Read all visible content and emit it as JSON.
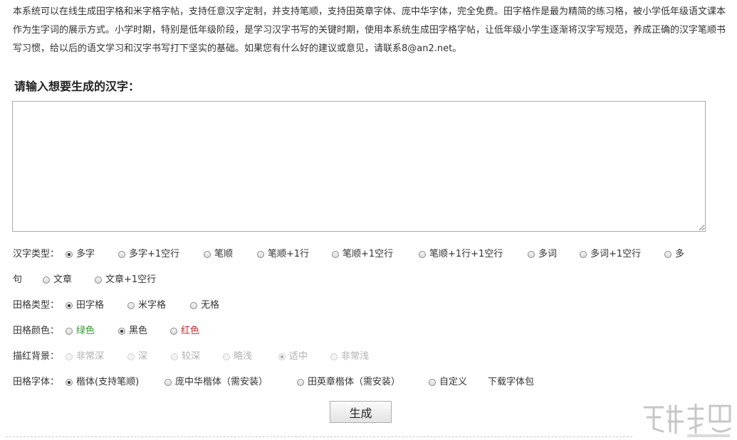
{
  "intro": {
    "text": "本系统可以在线生成田字格和米字格字帖，支持任意汉字定制，并支持笔顺，支持田英章字体、庞中华字体，完全免费。田字格作是最为精简的练习格，被小学低年级语文课本作为生字词的展示方式。小学时期，特别是低年级阶段，是学习汉字书写的关键时期，使用本系统生成田字格字帖，让低年级小学生逐渐将汉字写规范，养成正确的汉字笔顺书写习惯，给以后的语文学习和汉字书写打下坚实的基础。如果您有什么好的建议或意见，请联系8@an2.net。"
  },
  "prompt": {
    "title": "请输入想要生成的汉字：",
    "value": ""
  },
  "char_type": {
    "label": "汉字类型：",
    "options": [
      "多字",
      "多字+1空行",
      "笔顺",
      "笔顺+1行",
      "笔顺+1空行",
      "笔顺+1行+1空行",
      "多词",
      "多词+1空行",
      "多",
      "句",
      "文章",
      "文章+1空行"
    ],
    "selected": "多字"
  },
  "grid_type": {
    "label": "田格类型：",
    "options": [
      "田字格",
      "米字格",
      "无格"
    ],
    "selected": "田字格"
  },
  "grid_color": {
    "label": "田格颜色：",
    "options": [
      "绿色",
      "黑色",
      "红色"
    ],
    "selected": "黑色",
    "colors": {
      "green": "#2e9a2e",
      "red": "#c42b2b"
    }
  },
  "trace_bg": {
    "label": "描红背景：",
    "options": [
      "非常深",
      "深",
      "较深",
      "略浅",
      "适中",
      "非常浅"
    ],
    "selected": "适中"
  },
  "grid_font": {
    "label": "田格字体：",
    "options": [
      "楷体(支持笔顺)",
      "庞中华楷体（需安装）",
      "田英章楷体（需安装）",
      "自定义"
    ],
    "selected": "楷体(支持笔顺)",
    "download_link": "下载字体包"
  },
  "generate_button": {
    "label": "生成"
  }
}
